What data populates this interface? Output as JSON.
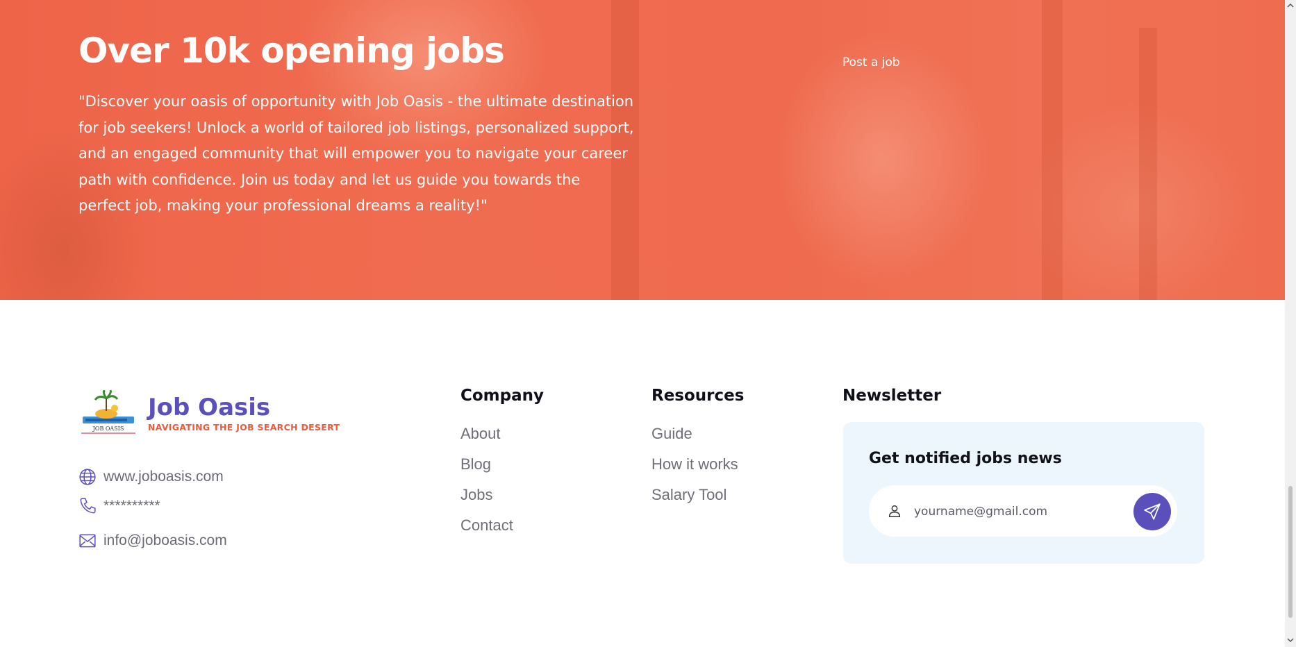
{
  "hero": {
    "title": "Over 10k opening jobs",
    "description": "\"Discover your oasis of opportunity with Job Oasis - the ultimate destination for job seekers! Unlock a world of tailored job listings, personalized support, and an engaged community that will empower you to navigate your career path with confidence. Join us today and let us guide you towards the perfect job, making your professional dreams a reality!\"",
    "post_job": "Post a job",
    "overlay_color": "#ef6a4e"
  },
  "brand": {
    "name": "Job Oasis",
    "tagline": "NAVIGATING THE JOB SEARCH DESERT",
    "logo_caption": "JOB OASIS",
    "name_color": "#5b4fbc",
    "tagline_color": "#ee5a3a"
  },
  "contact": {
    "website": "www.joboasis.com",
    "phone": "**********",
    "email": "info@joboasis.com"
  },
  "company": {
    "title": "Company",
    "links": [
      "About",
      "Blog",
      "Jobs",
      "Contact"
    ]
  },
  "resources": {
    "title": "Resources",
    "links": [
      "Guide",
      "How it works",
      "Salary Tool"
    ]
  },
  "newsletter": {
    "title": "Newsletter",
    "heading": "Get notified jobs news",
    "placeholder": "yourname@gmail.com",
    "send_icon": "paper-plane-icon",
    "accent": "#5b4fbc",
    "box_color": "#eef6fd"
  }
}
